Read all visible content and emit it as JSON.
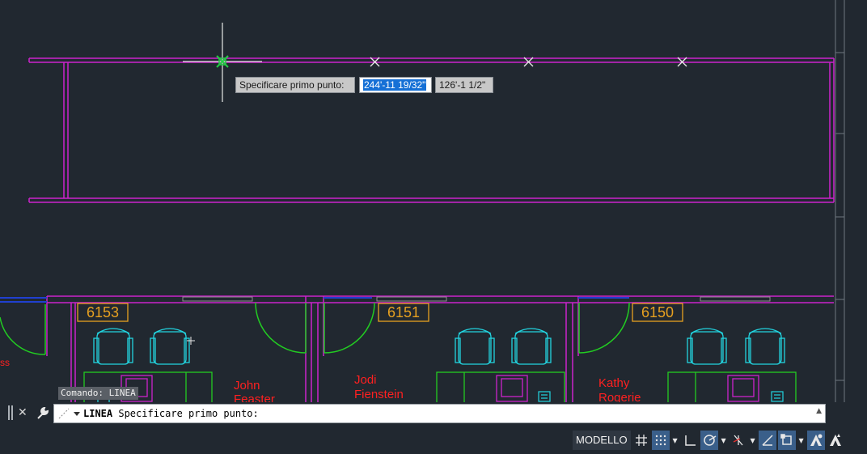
{
  "drawing": {
    "dynamic_prompt": "Specificare primo punto:",
    "coord_x": "244'-11 19/32\"",
    "coord_y": "126'-1 1/2\"",
    "rooms": [
      {
        "number": "6153",
        "occupant_line1": "John",
        "occupant_line2": "Feaster"
      },
      {
        "number": "6151",
        "occupant_line1": "Jodi",
        "occupant_line2": "Fienstein"
      },
      {
        "number": "6150",
        "occupant_line1": "Kathy",
        "occupant_line2": "Rogerie"
      }
    ],
    "partial_text": "ss",
    "colors": {
      "background": "#212830",
      "walls": "#cc22cc",
      "doors": "#22cc22",
      "chairs": "#22d4e0",
      "room_tags": "#e6a020",
      "names": "#ff2020"
    }
  },
  "command_line": {
    "history": "Comando: LINEA",
    "command_name": "LINEA",
    "prompt": "Specificare primo punto:"
  },
  "status_bar": {
    "model_tab": "MODELLO",
    "buttons": [
      "grid-icon",
      "snap-icon",
      "ortho-icon",
      "polar-icon",
      "osnap-tracking-icon",
      "isodraft-icon",
      "selection-cycling-icon",
      "annotation-icon",
      "autoscale-icon"
    ]
  }
}
